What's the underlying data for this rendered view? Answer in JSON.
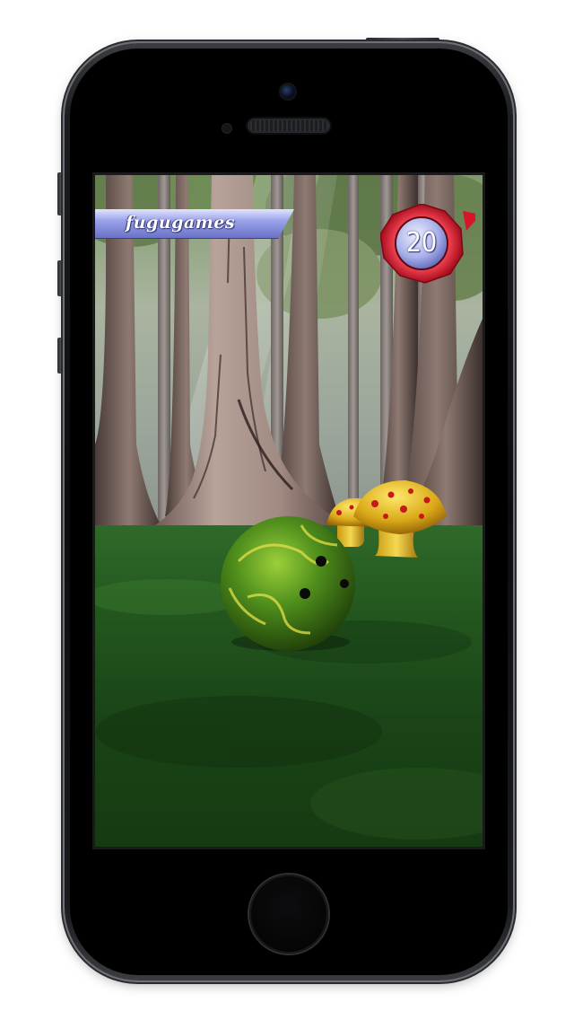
{
  "hud": {
    "player_name": "fugugames",
    "timer_value": "20"
  },
  "colors": {
    "banner": "#8c94e0",
    "timer_ring": "#c4142a",
    "timer_face": "#a9b0e8",
    "ground": "#2a5a22",
    "ball": "#4a8a20",
    "mushroom_cap": "#e0b422",
    "mushroom_spots": "#c81818"
  },
  "scene": {
    "setting": "forest",
    "objects": [
      "tree-trunk",
      "tree-trunk",
      "tree-trunk",
      "mushroom",
      "mushroom",
      "bowling-ball"
    ]
  }
}
